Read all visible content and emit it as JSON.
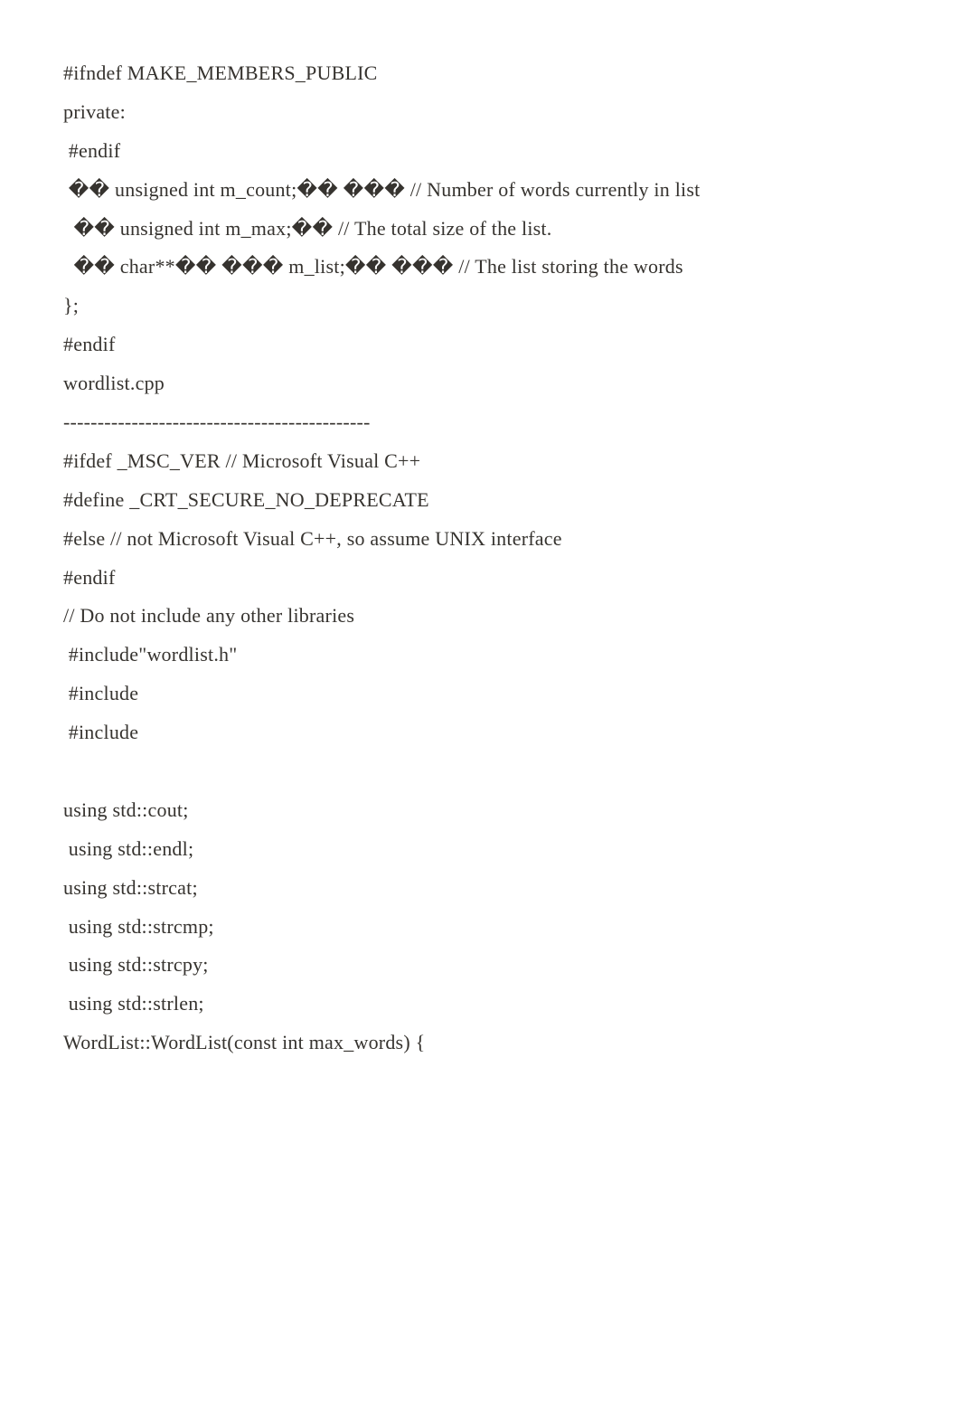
{
  "lines": [
    "#ifndef MAKE_MEMBERS_PUBLIC",
    "private:",
    " #endif",
    " �� unsigned int m_count;�� ��� // Number of words currently in list",
    "  �� unsigned int m_max;�� // The total size of the list.",
    "  �� char**�� ��� m_list;�� ��� // The list storing the words",
    "};",
    "#endif",
    "wordlist.cpp",
    "---------------------------------------------",
    "#ifdef _MSC_VER // Microsoft Visual C++",
    "#define _CRT_SECURE_NO_DEPRECATE",
    "#else // not Microsoft Visual C++, so assume UNIX interface",
    "#endif",
    "// Do not include any other libraries",
    " #include\"wordlist.h\"",
    " #include",
    " #include",
    "",
    "using std::cout;",
    " using std::endl;",
    "using std::strcat;",
    " using std::strcmp;",
    " using std::strcpy;",
    " using std::strlen;",
    "WordList::WordList(const int max_words) {"
  ]
}
